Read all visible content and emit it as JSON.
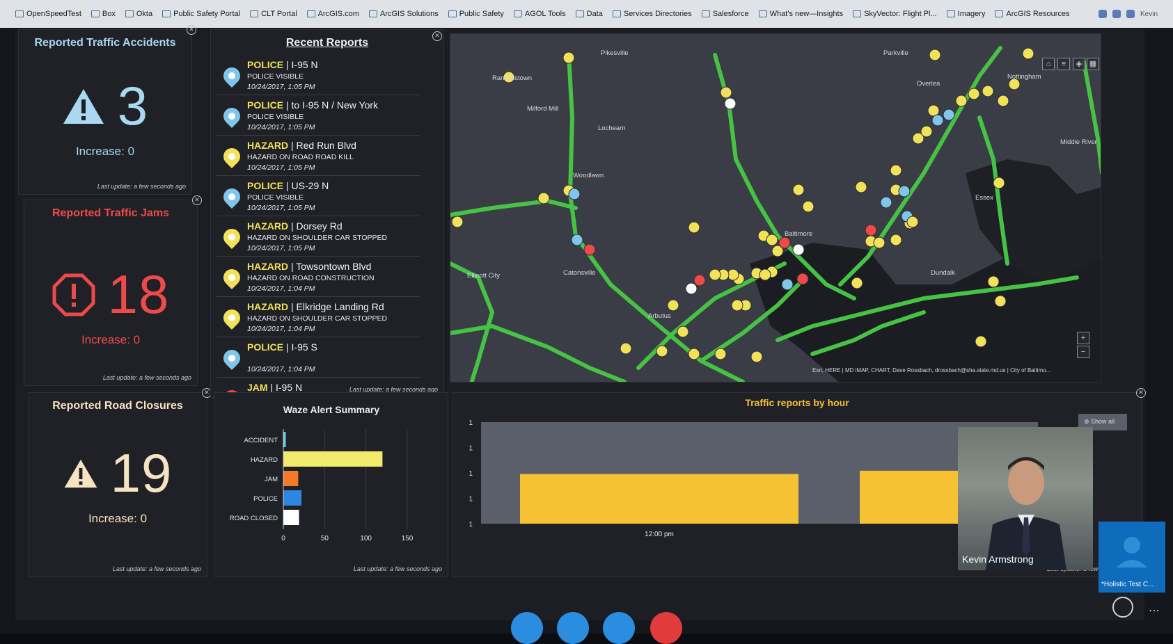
{
  "browser": {
    "bookmarks": [
      "OpenSpeedTest",
      "Box",
      "Okta",
      "Public Safety Portal",
      "CLT Portal",
      "ArcGIS.com",
      "ArcGIS Solutions",
      "Public Safety",
      "AGOL Tools",
      "Data",
      "Services Directories",
      "Salesforce",
      "What's new—Insights",
      "SkyVector: Flight Pl...",
      "Imagery",
      "ArcGIS Resources"
    ],
    "user": "Kevin"
  },
  "accidents": {
    "title": "Reported Traffic Accidents",
    "count": "3",
    "increase": "Increase: 0",
    "color": "#a9d8f0",
    "last_update": "Last update: a few seconds ago"
  },
  "jams": {
    "title": "Reported Traffic Jams",
    "count": "18",
    "increase": "Increase: 0",
    "color": "#ef4a4a",
    "last_update": "Last update: a few seconds ago"
  },
  "closures": {
    "title": "Reported Road Closures",
    "count": "19",
    "increase": "Increase: 0",
    "color": "#f6e3c2",
    "last_update": "Last update: a few seconds ago"
  },
  "recent": {
    "title": "Recent Reports",
    "last_update": "Last update: a few seconds ago",
    "items": [
      {
        "type": "POLICE",
        "loc": "I-95 N",
        "sub": "POLICE VISIBLE",
        "time": "10/24/2017, 1:05 PM",
        "icon": "police-pin-icon"
      },
      {
        "type": "POLICE",
        "loc": "to I-95 N / New York",
        "sub": "POLICE VISIBLE",
        "time": "10/24/2017, 1:05 PM",
        "icon": "police-pin-icon"
      },
      {
        "type": "HAZARD",
        "loc": "Red Run Blvd",
        "sub": "HAZARD ON ROAD ROAD KILL",
        "time": "10/24/2017, 1:05 PM",
        "icon": "hazard-pin-icon"
      },
      {
        "type": "POLICE",
        "loc": "US-29 N",
        "sub": "POLICE VISIBLE",
        "time": "10/24/2017, 1:05 PM",
        "icon": "police-pin-icon"
      },
      {
        "type": "HAZARD",
        "loc": "Dorsey Rd",
        "sub": "HAZARD ON SHOULDER CAR STOPPED",
        "time": "10/24/2017, 1:05 PM",
        "icon": "hazard-pin-icon"
      },
      {
        "type": "HAZARD",
        "loc": "Towsontown Blvd",
        "sub": "HAZARD ON ROAD CONSTRUCTION",
        "time": "10/24/2017, 1:04 PM",
        "icon": "hazard-pin-icon"
      },
      {
        "type": "HAZARD",
        "loc": "Elkridge Landing Rd",
        "sub": "HAZARD ON SHOULDER CAR STOPPED",
        "time": "10/24/2017, 1:04 PM",
        "icon": "hazard-pin-icon"
      },
      {
        "type": "POLICE",
        "loc": "I-95 S",
        "sub": "",
        "time": "10/24/2017, 1:04 PM",
        "icon": "police-pin-icon"
      },
      {
        "type": "JAM",
        "loc": "I-95 N",
        "sub": "",
        "time": "",
        "icon": "jam-pin-icon"
      }
    ]
  },
  "map": {
    "places": [
      "Pikesville",
      "Randallstown",
      "Milford Mill",
      "Lochearn",
      "Woodlawn",
      "Ellicott City",
      "Catonsville",
      "Arbutus",
      "Baltimore",
      "Dundalk",
      "Essex",
      "Parkville",
      "Overlea",
      "Middle River",
      "Nottingham"
    ],
    "attribution": "Esri, HERE | MD iMAP, CHART, Dave Rossbach, drossbach@sha.state.md.us | City of Baltimo...",
    "zoom_in": "+",
    "zoom_out": "−"
  },
  "waze": {
    "title": "Waze Alert Summary",
    "last_update": "Last update: a few seconds ago"
  },
  "hourly": {
    "title": "Traffic reports by hour",
    "show_all": "Show all",
    "last_update": "Last update: a few seconds ago"
  },
  "call": {
    "participant": "Kevin Armstrong",
    "self": "*Holistic Test C..."
  },
  "chart_data": [
    {
      "type": "bar",
      "orientation": "horizontal",
      "title": "Waze Alert Summary",
      "categories": [
        "ACCIDENT",
        "HAZARD",
        "JAM",
        "POLICE",
        "ROAD CLOSED"
      ],
      "values": [
        3,
        120,
        18,
        22,
        19
      ],
      "colors": [
        "#6fc3e8",
        "#f2ea6a",
        "#f47a2a",
        "#2f86e0",
        "#ffffff"
      ],
      "xlim": [
        0,
        150
      ],
      "xticks": [
        0,
        50,
        100,
        150
      ]
    },
    {
      "type": "bar",
      "title": "Traffic reports by hour",
      "yticks": [
        "1",
        "1",
        "1",
        "1",
        "1"
      ],
      "x_tick_label": "12:00 pm",
      "bars": [
        {
          "start": 0.07,
          "end": 0.57,
          "value": 0.75
        },
        {
          "start": 0.68,
          "end": 0.93,
          "value": 0.8
        },
        {
          "start": 0.96,
          "end": 1.0,
          "value": 0.85
        }
      ],
      "bar_color": "#f6c234",
      "plot_bg": "#5b5f6a"
    }
  ]
}
